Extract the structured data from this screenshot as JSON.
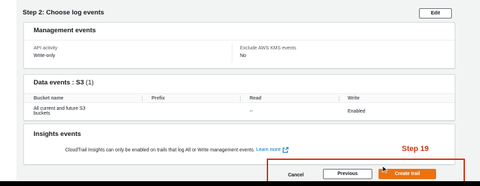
{
  "step": {
    "title": "Step 2: Choose log events",
    "edit_label": "Edit"
  },
  "management": {
    "title": "Management events",
    "api_activity_label": "API activity",
    "api_activity_value": "Write-only",
    "exclude_kms_label": "Exclude AWS KMS events",
    "exclude_kms_value": "No"
  },
  "data_events": {
    "title": "Data events : S3",
    "count": "(1)",
    "columns": [
      "Bucket name",
      "Prefix",
      "Read",
      "Write"
    ],
    "rows": [
      {
        "bucket_line1": "All current and future S3",
        "bucket_line2": "buckets",
        "prefix": "",
        "read": "--",
        "write": "Enabled"
      }
    ]
  },
  "insights": {
    "title": "Insights events",
    "text": "CloudTrail Insights can only be enabled on trails that log All or Write management events.",
    "learn_more": "Learn more"
  },
  "annotation": {
    "step_label": "Step 19",
    "color": "#d13212"
  },
  "actions": {
    "cancel": "Cancel",
    "previous": "Previous",
    "create": "Create trail"
  },
  "colors": {
    "primary": "#ec7211",
    "link": "#0073bb"
  }
}
